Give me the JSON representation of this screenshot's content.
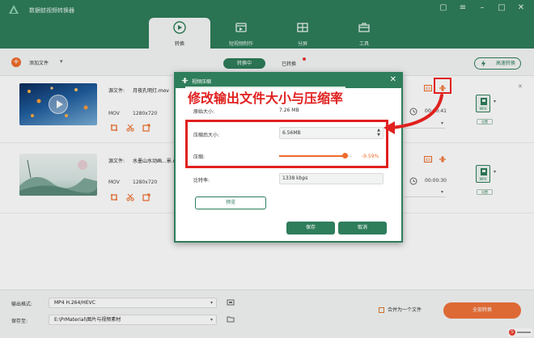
{
  "app": {
    "title": "数据蛙视频转换器"
  },
  "nav": {
    "tabs": [
      {
        "label": "转换",
        "icon": "convert-icon"
      },
      {
        "label": "短视频制作",
        "icon": "video-maker-icon"
      },
      {
        "label": "分屏",
        "icon": "split-screen-icon"
      },
      {
        "label": "工具",
        "icon": "toolbox-icon"
      }
    ]
  },
  "toolbar": {
    "add_label": "添加文件",
    "seg_active": "转换中",
    "seg_idle": "已转换",
    "fast_label": "高速转换"
  },
  "files": [
    {
      "source_label": "源文件:",
      "name": "月夜孔明灯.mov",
      "format": "MOV",
      "resolution": "1280x720",
      "duration": "00:00:41",
      "fmt_badge": "MP4",
      "settings_label": "设置"
    },
    {
      "source_label": "源文件:",
      "name": "水墨山水动画...景.mov",
      "format": "MOV",
      "resolution": "1280x720",
      "duration": "00:00:30",
      "fmt_badge": "MP4",
      "settings_label": "设置"
    }
  ],
  "dialog": {
    "title": "视频压缩",
    "original_label": "原始大小:",
    "original_value": "7.26 MB",
    "size_label": "压缩后大小:",
    "size_value": "6.56MB",
    "ratio_label": "压缩:",
    "ratio_value": "-9.59%",
    "ratio_fraction": 0.9,
    "bitrate_label": "比特率:",
    "bitrate_value": "1338 kbps",
    "preview_label": "预览",
    "ok_label": "保存",
    "cancel_label": "取消"
  },
  "annotation": {
    "text": "修改输出文件大小与压缩率",
    "color": "#e0201f"
  },
  "bottom": {
    "output_label": "输出格式:",
    "output_value": "MP4 H.264/HEVC",
    "save_label": "保存至:",
    "save_value": "E:\\PrMaterial\\图片与视频素材",
    "merge_label": "合并为一个文件",
    "convert_all_label": "全部转换"
  },
  "colors": {
    "brand": "#2e7d5b",
    "accent": "#ef6c2a",
    "annotation": "#e0201f"
  }
}
